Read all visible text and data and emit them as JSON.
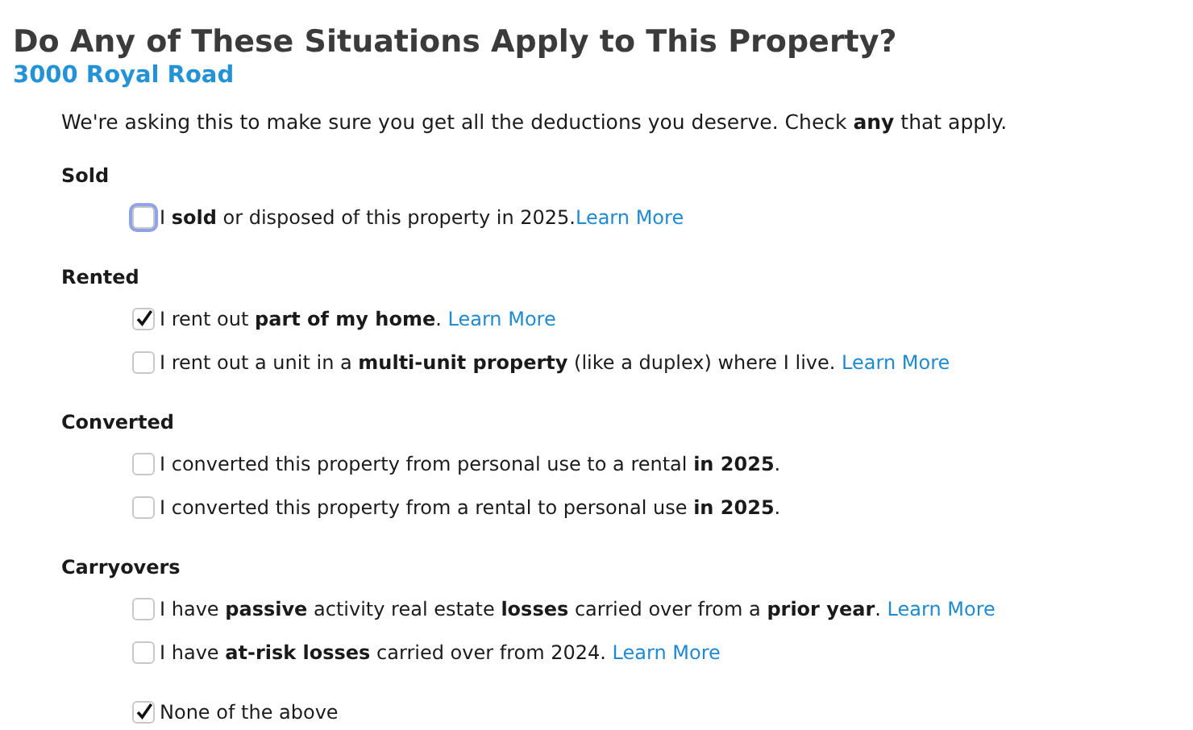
{
  "title": "Do Any of These Situations Apply to This Property?",
  "subtitle": "3000 Royal Road",
  "intro": "We're asking this to make sure you get all the deductions you deserve. Check **any** that apply.",
  "sections": [
    {
      "heading": "Sold",
      "options": [
        {
          "label": "I **sold** or disposed of this property in 2025.",
          "link": "Learn More",
          "checked": false,
          "focused": true
        }
      ]
    },
    {
      "heading": "Rented",
      "options": [
        {
          "label": "I rent out **part of my home**. ",
          "link": "Learn More",
          "checked": true,
          "focused": false
        },
        {
          "label": "I rent out a unit in a **multi-unit property** (like a duplex) where I live. ",
          "link": "Learn More",
          "checked": false,
          "focused": false
        }
      ]
    },
    {
      "heading": "Converted",
      "options": [
        {
          "label": "I converted this property from personal use to a rental **in 2025**.",
          "checked": false,
          "focused": false
        },
        {
          "label": "I converted this property from a rental to personal use **in 2025**.",
          "checked": false,
          "focused": false
        }
      ]
    },
    {
      "heading": "Carryovers",
      "options": [
        {
          "label": "I have **passive** activity real estate **losses** carried over from a **prior year**. ",
          "link": "Learn More",
          "checked": false,
          "focused": false
        },
        {
          "label": "I have **at-risk losses** carried over from 2024. ",
          "link": "Learn More",
          "checked": false,
          "focused": false
        }
      ]
    }
  ],
  "none_option": {
    "label": "None of the above",
    "checked": true,
    "focused": false
  }
}
